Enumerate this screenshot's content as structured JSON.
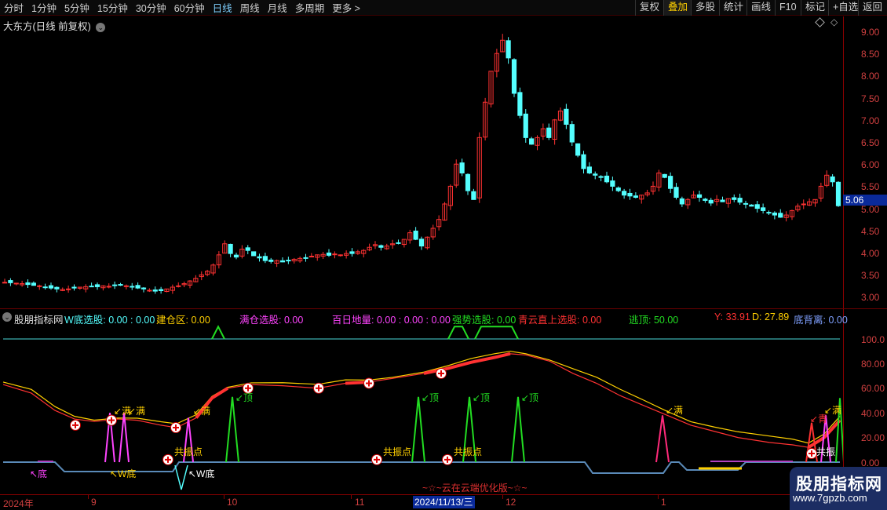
{
  "toolbar": {
    "timeframes": [
      "分时",
      "1分钟",
      "5分钟",
      "15分钟",
      "30分钟",
      "60分钟",
      "日线",
      "周线",
      "月线",
      "多周期",
      "更多 >"
    ],
    "active_timeframe": "日线",
    "right_buttons": [
      "复权",
      "叠加",
      "多股",
      "统计",
      "画线",
      "F10",
      "标记",
      "+自选",
      "返回"
    ],
    "active_right": "叠加"
  },
  "main_chart": {
    "title": "大东方(日线 前复权)",
    "price_label": "5.06",
    "y_labels": [
      "9.00",
      "8.50",
      "8.00",
      "7.50",
      "7.00",
      "6.50",
      "6.00",
      "5.50",
      "5.00",
      "4.50",
      "4.00",
      "3.50",
      "3.00"
    ]
  },
  "indicator": {
    "name": "股朋指标网",
    "legend": {
      "wdi": "W底选股: 0.00 : 0.00",
      "jiancang": "建仓区: 0.00",
      "mancang": "满仓选股: 0.00",
      "bairi": "百日地量: 0.00 : 0.00 : 0.00",
      "qiangshi": "强势选股: 0.00",
      "qingyun": "青云直上选股: 0.00",
      "taoding": "逃顶: 50.00",
      "y": "Y: 33.91",
      "d": "D: 27.89",
      "dibeili": "底背离: 0.00"
    },
    "y_labels": [
      "100.0",
      "80.00",
      "60.00",
      "40.00",
      "20.00",
      "0.00"
    ],
    "annotations": {
      "man": "满",
      "ding": "顶",
      "wdi": "W底",
      "gongzhen": "共振点",
      "di": "底",
      "qing": "青",
      "zhen": "振"
    },
    "footer_text": "~☆~云在云端优化版~☆~"
  },
  "time_axis": {
    "labels": [
      "2024年",
      "9",
      "10",
      "11",
      "12",
      "1"
    ],
    "selected_date": "2024/11/13/三"
  },
  "watermark": {
    "line1": "股朋指标网",
    "line2": "www.7gpzb.com"
  },
  "colors": {
    "up": "#ff3232",
    "down": "#54ffff",
    "axis": "#d04040",
    "magenta": "#ff44ff",
    "green": "#22dd22",
    "yellow": "#ffd000"
  }
}
